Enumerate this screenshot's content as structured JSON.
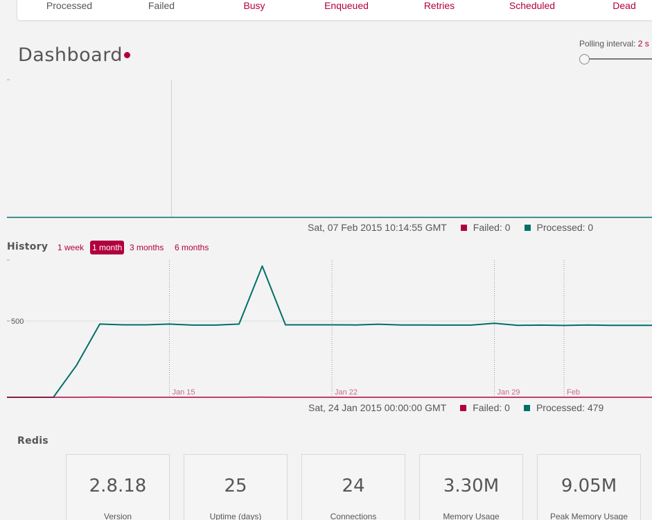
{
  "summary": {
    "items": [
      {
        "label": "Processed",
        "tone": "gray"
      },
      {
        "label": "Failed",
        "tone": "gray"
      },
      {
        "label": "Busy",
        "tone": "red"
      },
      {
        "label": "Enqueued",
        "tone": "red"
      },
      {
        "label": "Retries",
        "tone": "red"
      },
      {
        "label": "Scheduled",
        "tone": "red"
      },
      {
        "label": "Dead",
        "tone": "red"
      }
    ]
  },
  "header": {
    "title": "Dashboard",
    "polling_label": "Polling interval:",
    "polling_value": "2 s",
    "polling_slider_level": 0
  },
  "realtime": {
    "hover_date": "Sat, 07 Feb 2015 10:14:55 GMT",
    "failed_text": "Failed: 0",
    "processed_text": "Processed: 0"
  },
  "history": {
    "label": "History",
    "ranges": [
      "1 week",
      "1 month",
      "3 months",
      "6 months"
    ],
    "active_range": "1 month",
    "hover_date": "Sat, 24 Jan 2015 00:00:00 GMT",
    "failed_text": "Failed: 0",
    "processed_text": "Processed: 479"
  },
  "chart_data": {
    "type": "line",
    "title": "",
    "xlabel": "",
    "ylabel": "",
    "ylim": [
      0,
      900
    ],
    "ytick_labels": [
      "500"
    ],
    "xtick_labels": [
      "Jan 15",
      "Jan 22",
      "Jan 29",
      "Feb"
    ],
    "x": [
      "Jan 9",
      "Jan 10",
      "Jan 11",
      "Jan 12",
      "Jan 13",
      "Jan 14",
      "Jan 15",
      "Jan 16",
      "Jan 17",
      "Jan 18",
      "Jan 19",
      "Jan 20",
      "Jan 21",
      "Jan 22",
      "Jan 23",
      "Jan 24",
      "Jan 25",
      "Jan 26",
      "Jan 27",
      "Jan 28",
      "Jan 29",
      "Jan 30",
      "Jan 31",
      "Feb 1",
      "Feb 2",
      "Feb 3",
      "Feb 4",
      "Feb 5"
    ],
    "series": [
      {
        "name": "Processed",
        "color": "#006f68",
        "values": [
          0,
          0,
          210,
          480,
          475,
          475,
          480,
          473,
          473,
          480,
          860,
          475,
          475,
          475,
          474,
          479,
          474,
          474,
          473,
          473,
          485,
          472,
          473,
          471,
          474,
          472,
          472,
          472
        ]
      },
      {
        "name": "Failed",
        "color": "#b1003e",
        "values": [
          0,
          0,
          0,
          1,
          0,
          0,
          0,
          0,
          0,
          0,
          1,
          0,
          0,
          0,
          0,
          0,
          0,
          0,
          0,
          0,
          0,
          0,
          0,
          0,
          0,
          0,
          0,
          0
        ]
      }
    ],
    "grid": true,
    "legend": "none"
  },
  "redis": {
    "label": "Redis",
    "stats": [
      {
        "value": "2.8.18",
        "label": "Version"
      },
      {
        "value": "25",
        "label": "Uptime (days)"
      },
      {
        "value": "24",
        "label": "Connections"
      },
      {
        "value": "3.30M",
        "label": "Memory Usage"
      },
      {
        "value": "9.05M",
        "label": "Peak Memory Usage"
      }
    ]
  },
  "colors": {
    "accent": "#b1003e",
    "processed": "#006f68",
    "text": "#585454",
    "background": "#f3f3f3"
  }
}
